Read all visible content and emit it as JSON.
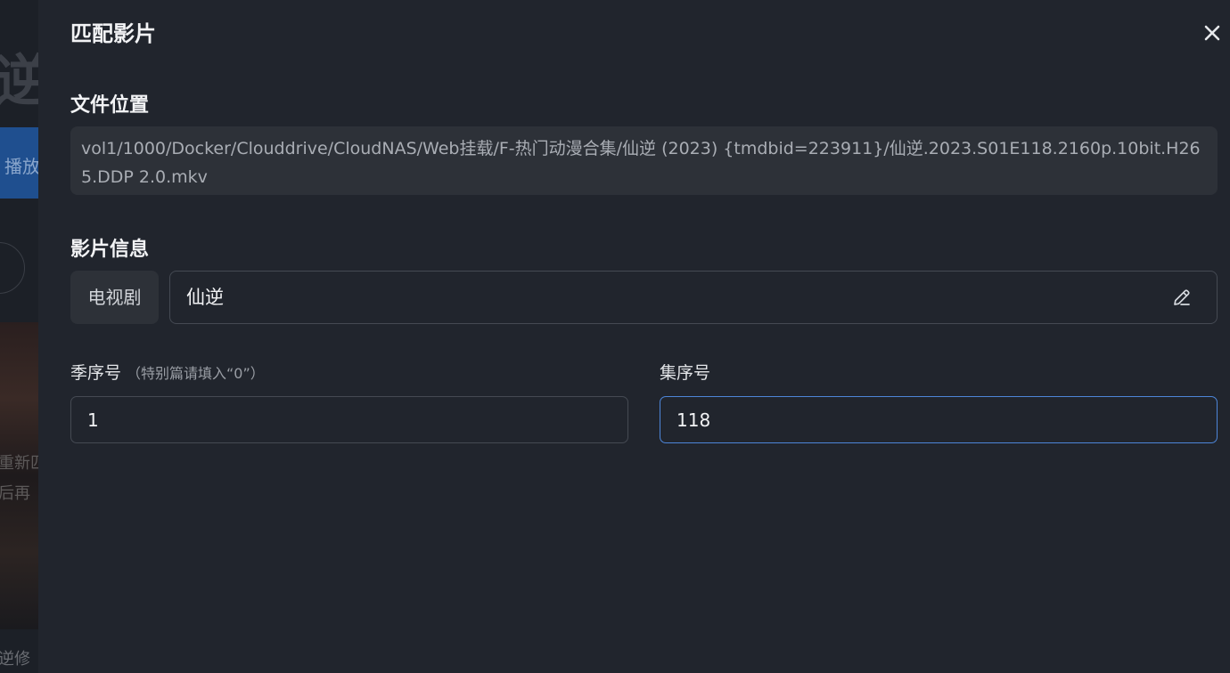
{
  "background": {
    "title_fragment": "逆",
    "play_label": "播放",
    "poster_line1": "重新匹",
    "poster_line2": "后再",
    "bottom_text": "逆修"
  },
  "dialog": {
    "title": "匹配影片",
    "close_icon": "close-icon",
    "file_location": {
      "label": "文件位置",
      "path": "vol1/1000/Docker/Clouddrive/CloudNAS/Web挂载/F-热门动漫合集/仙逆 (2023) {tmdbid=223911}/仙逆.2023.S01E118.2160p.10bit.H265.DDP 2.0.mkv"
    },
    "media_info": {
      "label": "影片信息",
      "type": "电视剧",
      "title_value": "仙逆",
      "edit_icon": "pencil-icon"
    },
    "season": {
      "label": "季序号",
      "hint": "（特别篇请填入“0”）",
      "value": "1"
    },
    "episode": {
      "label": "集序号",
      "value": "118"
    }
  },
  "colors": {
    "dialog_bg": "#21252d",
    "path_bg": "#2d3138",
    "focus_border": "#4d86d9",
    "play_button_bg": "#1f4f8f"
  }
}
